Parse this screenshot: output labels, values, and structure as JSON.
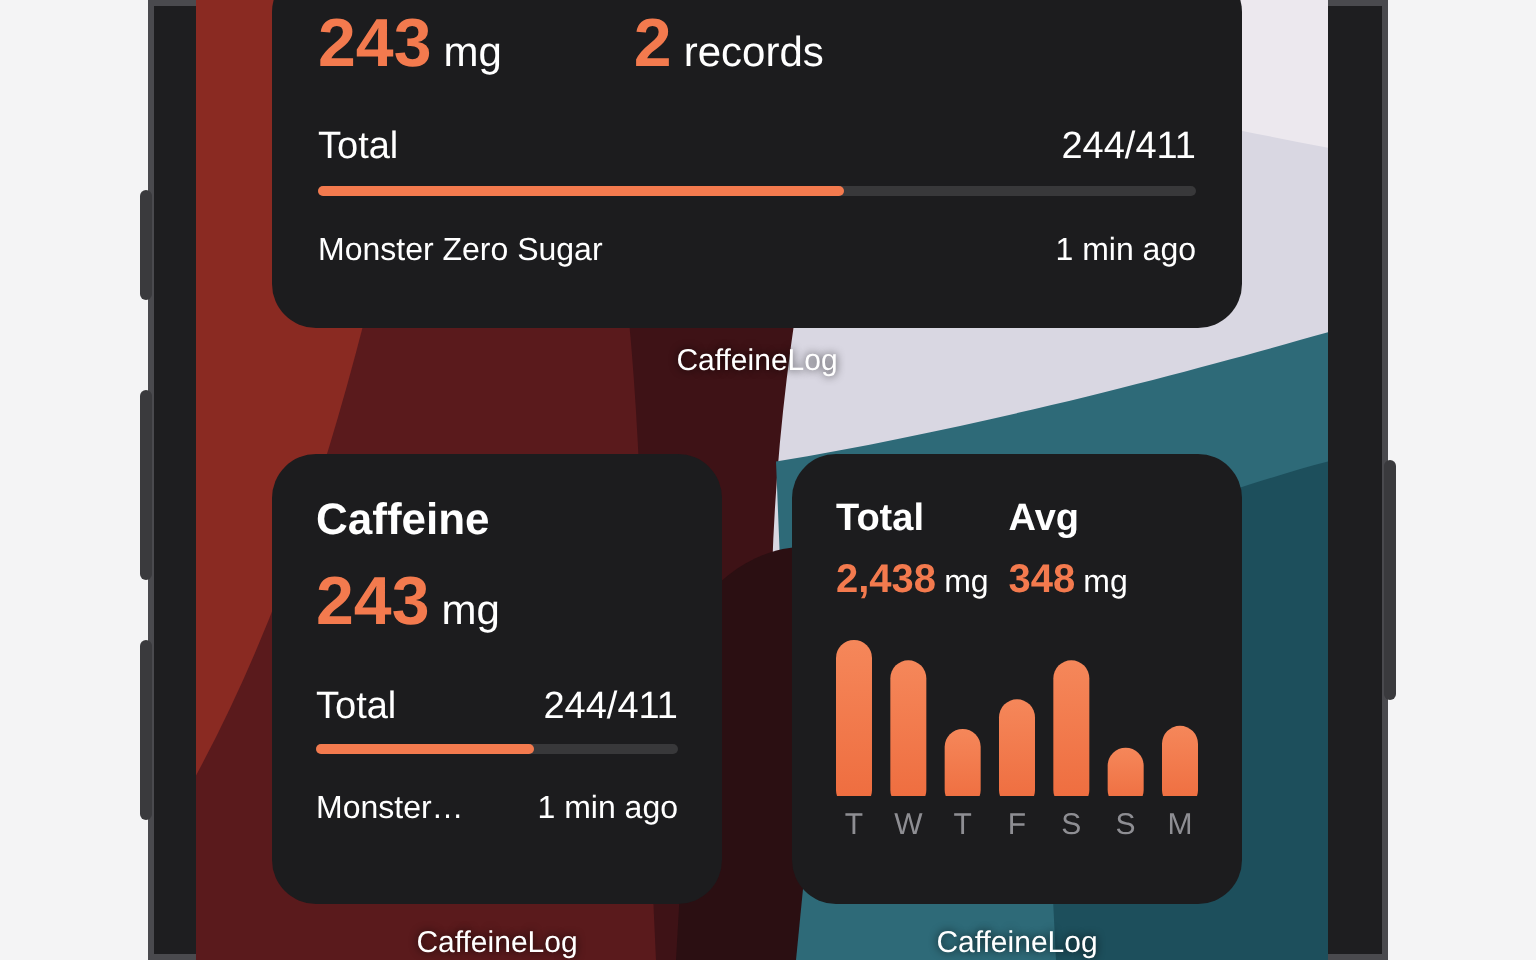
{
  "widgets": [
    {
      "kind": "medium",
      "amount": "243",
      "unit": "mg",
      "count": "2",
      "count_unit": "records",
      "total_label": "Total",
      "total_value": "244/411",
      "level": 0.6,
      "last_drink": "Monster Zero Sugar",
      "time": "1 min ago",
      "app": "CaffeineLog"
    },
    {
      "kind": "small",
      "title": "Caffeine",
      "amount": "243",
      "unit": "mg",
      "total_label": "Total",
      "total_value": "244/411",
      "level": 0.6,
      "last_drink": "Monster…",
      "time": "1 min ago",
      "app": "CaffeineLog"
    },
    {
      "kind": "chart",
      "total_label": "Total",
      "total_value": "2,438",
      "total_unit": "mg",
      "avg_label": "Avg",
      "avg_value": "348",
      "avg_unit": "mg",
      "days": [
        "T",
        "W",
        "T",
        "F",
        "S",
        "S",
        "M"
      ],
      "app": "CaffeineLog"
    }
  ]
}
